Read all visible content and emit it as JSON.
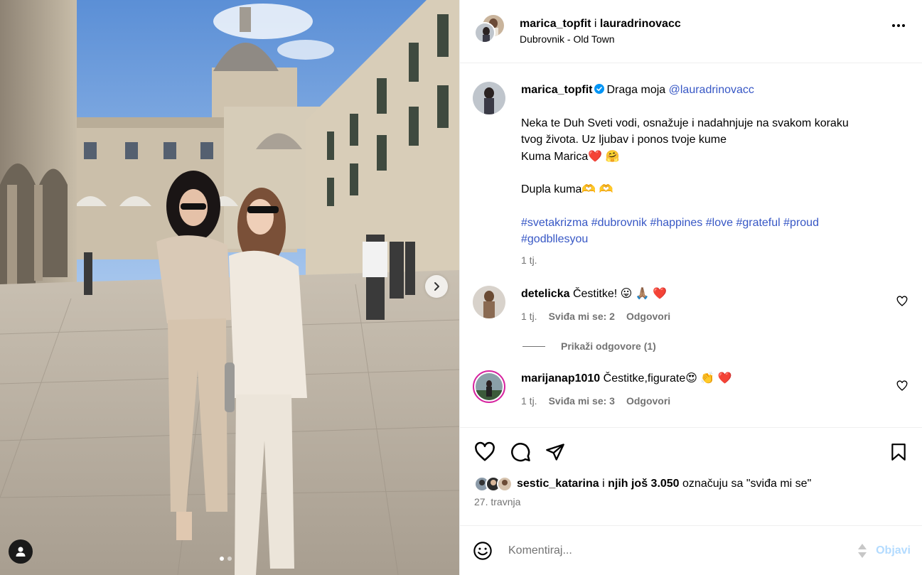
{
  "post": {
    "header": {
      "author": "marica_topfit",
      "joiner": " i ",
      "coauthor": "lauradrinovacc",
      "location": "Dubrovnik - Old Town"
    },
    "caption": {
      "username": "marica_topfit",
      "intro": "Draga moja ",
      "mention": "@lauradrinovacc",
      "lines": [
        "Neka te Duh Sveti vodi, osnažuje i nadahnjuje na svakom koraku",
        "tvog života. Uz ljubav i ponos tvoje kume",
        "Kuma Marica❤️ 🤗",
        "",
        "Dupla kuma🫶 🫶"
      ],
      "hashtags": [
        "#svetakrizma",
        "#dubrovnik",
        "#happines",
        "#love",
        "#grateful",
        "#proud",
        "#godbllesyou"
      ],
      "time": "1 tj."
    },
    "comments": [
      {
        "username": "detelicka",
        "text": "Čestitke! 😛 🙏🏽 ❤️",
        "time": "1 tj.",
        "likes": "Sviđa mi se: 2",
        "reply": "Odgovori"
      },
      {
        "username": "marijanap1010",
        "text": "Čestitke,figurate😍 👏 ❤️",
        "time": "1 tj.",
        "likes": "Sviđa mi se: 3",
        "reply": "Odgovori"
      }
    ],
    "view_replies": "Prikaži odgovore (1)",
    "likes": {
      "first_user": "sestic_katarina",
      "joiner": " i ",
      "others": "njih još 3.050",
      "suffix": " označuju sa \"sviđa mi se\""
    },
    "date": "27. travnja",
    "comment_box": {
      "placeholder": "Komentiraj...",
      "post_label": "Objavi"
    },
    "carousel": {
      "total": 2,
      "current": 1
    }
  },
  "icons": {
    "more": "more-horizontal-icon",
    "like": "heart-icon",
    "comment": "comment-icon",
    "share": "paper-plane-icon",
    "save": "bookmark-icon",
    "emoji": "smiley-icon",
    "next": "chevron-right-icon",
    "tag": "user-tag-icon",
    "verified": "verified-badge-icon"
  },
  "colors": {
    "link": "#3757c5",
    "muted": "#737373",
    "verified": "#0095f6",
    "post_disabled": "#b3dbff",
    "like_red": "#ff3040"
  }
}
